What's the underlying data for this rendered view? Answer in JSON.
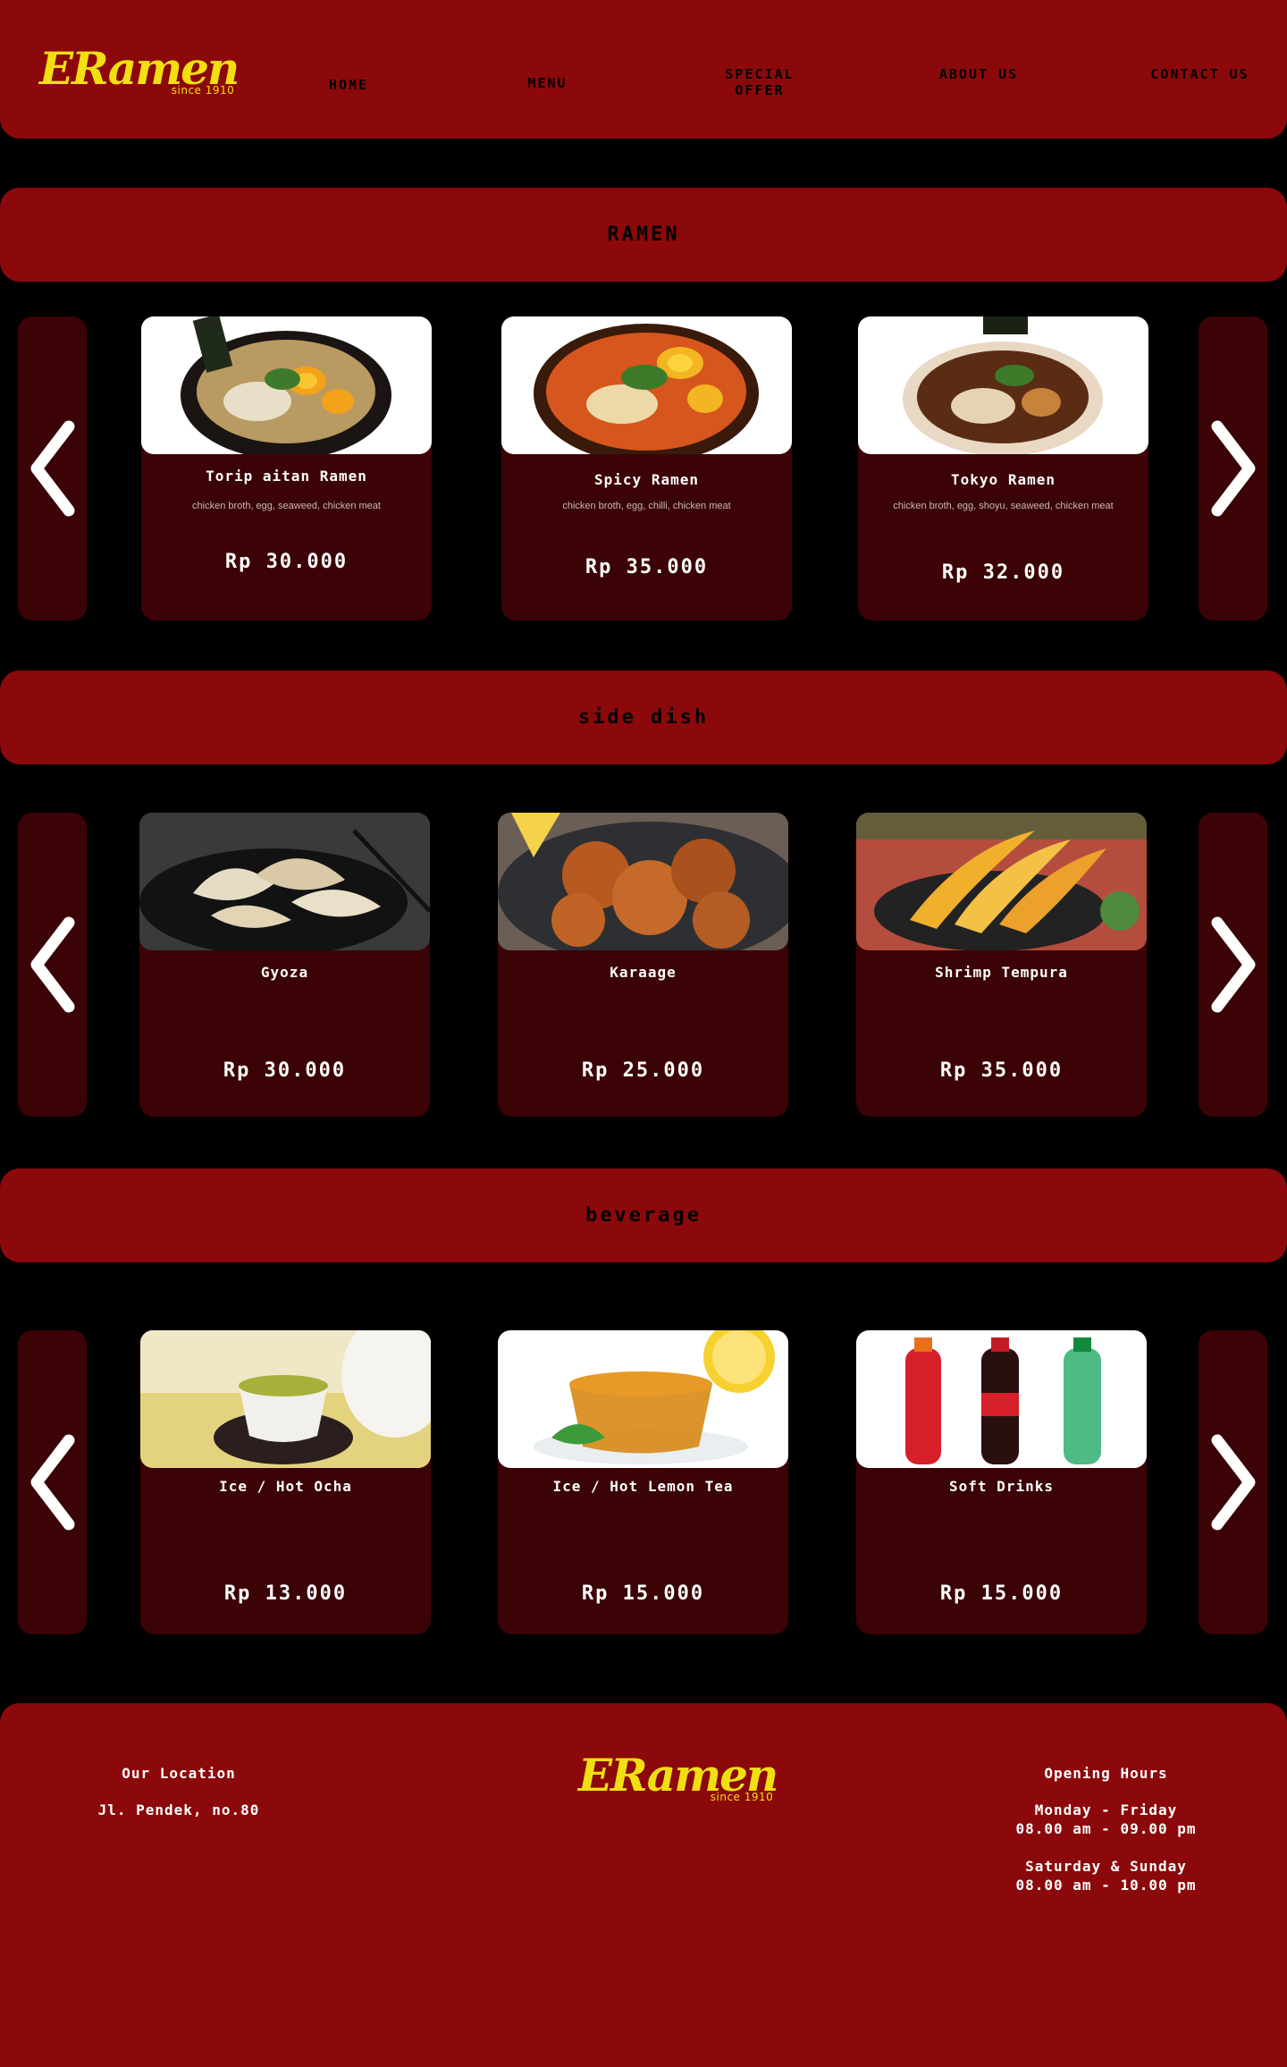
{
  "brand": {
    "name": "ERamen",
    "since": "since 1910"
  },
  "nav": [
    {
      "label": "HOME"
    },
    {
      "label": "MENU"
    },
    {
      "label": "SPECIAL OFFER"
    },
    {
      "label": "ABOUT US"
    },
    {
      "label": "CONTACT US"
    }
  ],
  "sections": [
    {
      "title": "RAMEN",
      "items": [
        {
          "name": "Torip aitan Ramen",
          "desc": "chicken broth, egg, seaweed, chicken meat",
          "price": "Rp 30.000"
        },
        {
          "name": "Spicy Ramen",
          "desc": "chicken broth, egg, chilli, chicken meat",
          "price": "Rp 35.000"
        },
        {
          "name": "Tokyo Ramen",
          "desc": "chicken broth, egg, shoyu, seaweed,  chicken meat",
          "price": "Rp 32.000"
        }
      ]
    },
    {
      "title": "side dish",
      "items": [
        {
          "name": "Gyoza",
          "price": "Rp 30.000"
        },
        {
          "name": "Karaage",
          "price": "Rp 25.000"
        },
        {
          "name": "Shrimp Tempura",
          "price": "Rp 35.000"
        }
      ]
    },
    {
      "title": "beverage",
      "items": [
        {
          "name": "Ice / Hot Ocha",
          "price": "Rp 13.000"
        },
        {
          "name": "Ice / Hot Lemon Tea",
          "price": "Rp 15.000"
        },
        {
          "name": "Soft Drinks",
          "price": "Rp 15.000"
        }
      ]
    }
  ],
  "footer": {
    "location_title": "Our Location",
    "location_address": "Jl. Pendek, no.80",
    "hours_title": "Opening Hours",
    "weekday_label": "Monday - Friday",
    "weekday_hours": "08.00 am - 09.00 pm",
    "weekend_label": "Saturday & Sunday",
    "weekend_hours": "08.00 am - 10.00 pm"
  },
  "colors": {
    "primary_red": "#8c090b",
    "card_dark": "#3b0305",
    "background": "#000000",
    "logo_yellow": "#f2df12"
  },
  "icons": {
    "prev": "chevron-left-icon",
    "next": "chevron-right-icon"
  }
}
